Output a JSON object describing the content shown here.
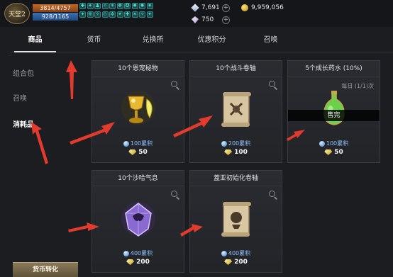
{
  "status": {
    "logo_text": "天堂2",
    "hp": "3814/4757",
    "mp": "928/1165",
    "diamond_count": "7,691",
    "gold_count": "9,959,056",
    "gem_count": "750"
  },
  "tabs": [
    {
      "label": "商品"
    },
    {
      "label": "货币"
    },
    {
      "label": "兑换所"
    },
    {
      "label": "优惠积分"
    },
    {
      "label": "召唤"
    }
  ],
  "sidebar": {
    "items": [
      {
        "label": "组合包"
      },
      {
        "label": "召唤"
      },
      {
        "label": "消耗品"
      }
    ],
    "convert_label": "货币转化"
  },
  "items": [
    {
      "title": "10个恩宠秘物",
      "accum": "100累积",
      "price": "50"
    },
    {
      "title": "10个战斗卷轴",
      "accum": "200累积",
      "price": "100"
    },
    {
      "title": "5个成长药水 (10%)",
      "limit": "每日 (1/1)次",
      "soldout": "售完",
      "accum": "100累积",
      "price": "50"
    },
    {
      "title": "10个沙哈气息",
      "accum": "400累积",
      "price": "200"
    },
    {
      "title": "蓋亚初始化卷轴",
      "accum": "400累积",
      "price": "200"
    }
  ],
  "colors": {
    "background": "#1c1d21",
    "card": "#2a2c32",
    "accent_arrow": "#e23b2e",
    "accum_blue": "#8ec2ff"
  }
}
